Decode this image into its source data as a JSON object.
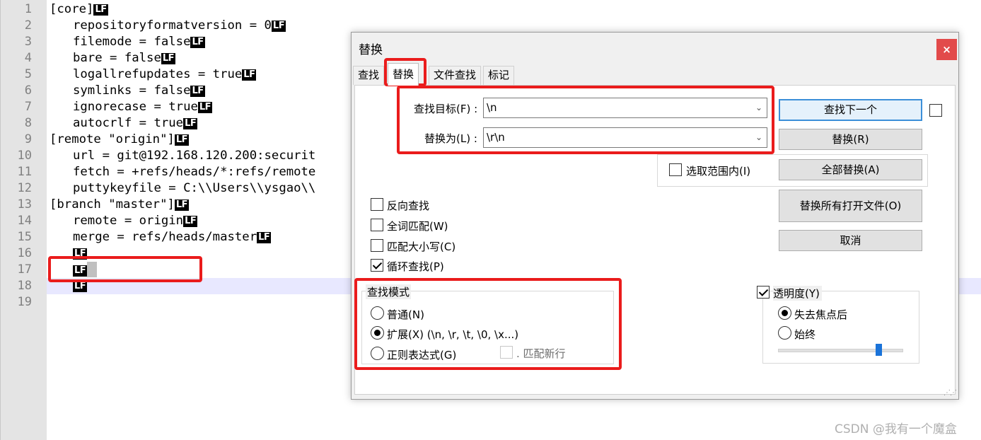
{
  "editor": {
    "line_numbers": [
      "1",
      "2",
      "3",
      "4",
      "5",
      "6",
      "7",
      "8",
      "9",
      "10",
      "11",
      "12",
      "13",
      "14",
      "15",
      "16",
      "17",
      "18",
      "19"
    ],
    "lines": [
      {
        "text": "[core]",
        "eol": "LF",
        "indent": false
      },
      {
        "text": "repositoryformatversion = 0",
        "eol": "LF",
        "indent": true
      },
      {
        "text": "filemode = false",
        "eol": "LF",
        "indent": true
      },
      {
        "text": "bare = false",
        "eol": "LF",
        "indent": true
      },
      {
        "text": "logallrefupdates = true",
        "eol": "LF",
        "indent": true
      },
      {
        "text": "symlinks = false",
        "eol": "LF",
        "indent": true
      },
      {
        "text": "ignorecase = true",
        "eol": "LF",
        "indent": true
      },
      {
        "text": "autocrlf = true",
        "eol": "LF",
        "indent": true
      },
      {
        "text": "[remote \"origin\"]",
        "eol": "LF",
        "indent": false
      },
      {
        "text": "url = git@192.168.120.200:securit",
        "eol": "",
        "indent": true
      },
      {
        "text": "fetch = +refs/heads/*:refs/remote",
        "eol": "",
        "indent": true
      },
      {
        "text": "puttykeyfile = C:\\\\Users\\\\ysgao\\\\",
        "eol": "",
        "indent": true
      },
      {
        "text": "[branch \"master\"]",
        "eol": "LF",
        "indent": false
      },
      {
        "text": "remote = origin",
        "eol": "LF",
        "indent": true
      },
      {
        "text": "merge = refs/heads/master",
        "eol": "LF",
        "indent": true
      },
      {
        "text": "",
        "eol": "LF",
        "indent": true
      },
      {
        "text": "",
        "eol": "LF",
        "indent": true
      },
      {
        "text": "",
        "eol": "LF",
        "indent": true
      },
      {
        "text": "",
        "eol": "",
        "indent": false
      }
    ]
  },
  "dialog": {
    "title": "替换",
    "close": "×",
    "tabs": [
      "查找",
      "替换",
      "文件查找",
      "标记"
    ],
    "find_label": "查找目标(F) :",
    "find_value": "\\n",
    "replace_label": "替换为(L) :",
    "replace_value": "\\r\\n",
    "buttons": {
      "find_next": "查找下一个",
      "replace": "替换(R)",
      "replace_all": "全部替换(A)",
      "replace_all_open": "替换所有打开文件(O)",
      "cancel": "取消"
    },
    "in_selection": "选取范围内(I)",
    "options": {
      "backward": "反向查找",
      "whole_word": "全词匹配(W)",
      "match_case": "匹配大小写(C)",
      "wrap": "循环查找(P)"
    },
    "search_mode": {
      "title": "查找模式",
      "normal": "普通(N)",
      "extended": "扩展(X) (\\n, \\r, \\t, \\0, \\x...)",
      "regex": "正则表达式(G)",
      "dot_newline": ". 匹配新行",
      "selected": "extended"
    },
    "transparency": {
      "label": "透明度(Y)",
      "on_lose_focus": "失去焦点后",
      "always": "始终",
      "selected": "on_lose_focus",
      "level": 0.8
    }
  },
  "watermark": "CSDN @我有一个魔盒",
  "colors": {
    "highlight_red": "#ea1c1c",
    "accent_blue": "#3c8fd8",
    "current_line": "#e8e8ff"
  }
}
